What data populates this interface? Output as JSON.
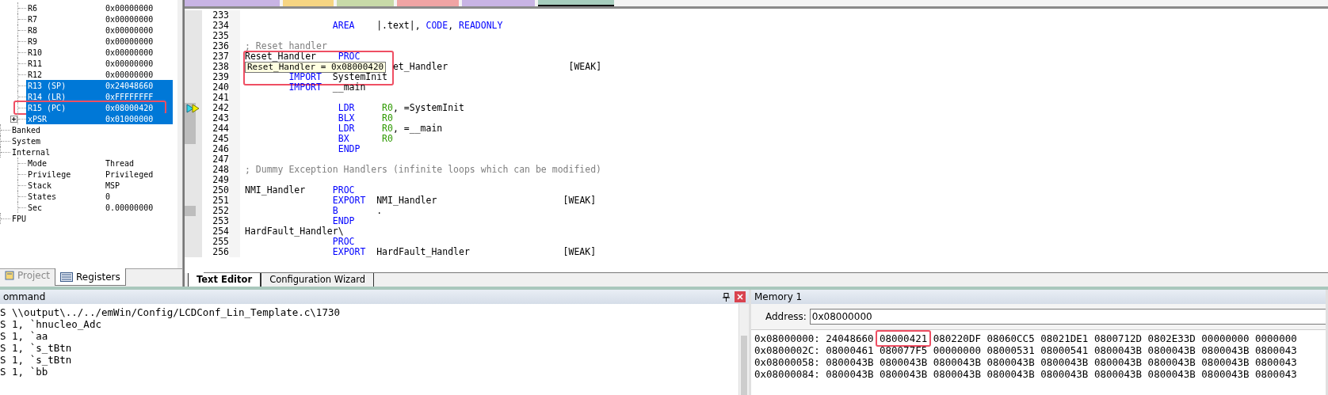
{
  "file_tabs": [
    {
      "color": "#c8b4e4",
      "selected": false
    },
    {
      "color": "#f6d582",
      "selected": false
    },
    {
      "color": "#c8daa8",
      "selected": false
    },
    {
      "color": "#f0a4a4",
      "selected": false
    },
    {
      "color": "#c8b4e4",
      "selected": false
    },
    {
      "color": "#a6cdbd",
      "selected": true
    }
  ],
  "registers": {
    "continued": [
      {
        "name": "R6",
        "value": "0x00000000",
        "selected": false,
        "highlighted": false
      },
      {
        "name": "R7",
        "value": "0x00000000",
        "selected": false,
        "highlighted": false
      },
      {
        "name": "R8",
        "value": "0x00000000",
        "selected": false,
        "highlighted": false
      },
      {
        "name": "R9",
        "value": "0x00000000",
        "selected": false,
        "highlighted": false
      },
      {
        "name": "R10",
        "value": "0x00000000",
        "selected": false,
        "highlighted": false
      },
      {
        "name": "R11",
        "value": "0x00000000",
        "selected": false,
        "highlighted": false
      },
      {
        "name": "R12",
        "value": "0x00000000",
        "selected": false,
        "highlighted": false
      },
      {
        "name": "R13 (SP)",
        "value": "0x24048660",
        "selected": true,
        "highlighted": false
      },
      {
        "name": "R14 (LR)",
        "value": "0xFFFFFFFF",
        "selected": true,
        "highlighted": false
      },
      {
        "name": "R15 (PC)",
        "value": "0x08000420",
        "selected": true,
        "highlighted": true
      },
      {
        "name": "xPSR",
        "value": "0x01000000",
        "selected": true,
        "highlighted": false,
        "expanded": false
      }
    ],
    "items": [
      {
        "name": "Banked"
      },
      {
        "name": "System"
      },
      {
        "name": "Internal",
        "children": [
          {
            "name": "Mode",
            "value": "Thread"
          },
          {
            "name": "Privilege",
            "value": "Privileged"
          },
          {
            "name": "Stack",
            "value": "MSP"
          },
          {
            "name": "States",
            "value": "0"
          },
          {
            "name": "Sec",
            "value": "0.00000000"
          }
        ]
      },
      {
        "name": "FPU"
      }
    ]
  },
  "left_tabs": [
    {
      "label": "Project",
      "selected": false,
      "kind": "project"
    },
    {
      "label": "Registers",
      "selected": true,
      "kind": "registers"
    }
  ],
  "editor": {
    "tooltip": {
      "text": "Reset_Handler = 0x08000420",
      "highlighted": true
    },
    "lines": [
      {
        "n": "233",
        "marked": false,
        "current": false
      },
      {
        "n": "234",
        "marked": false,
        "current": false,
        "tokens": [
          {
            "text": "                AREA",
            "kind": "keyword"
          },
          {
            "text": "    |.text|, ",
            "kind": "plain"
          },
          {
            "text": "CODE",
            "kind": "keyword"
          },
          {
            "text": ", ",
            "kind": "plain"
          },
          {
            "text": "READONLY",
            "kind": "keyword"
          }
        ]
      },
      {
        "n": "235",
        "marked": false,
        "current": false
      },
      {
        "n": "236",
        "marked": false,
        "current": false,
        "tokens": [
          {
            "text": "; Reset handler",
            "kind": "comment"
          }
        ]
      },
      {
        "n": "237",
        "marked": false,
        "current": false,
        "tokens": [
          {
            "text": "Reset_Handler",
            "kind": "plain"
          },
          {
            "text": "    PROC",
            "kind": "keyword"
          }
        ]
      },
      {
        "n": "238",
        "marked": false,
        "current": false,
        "tokens": [
          {
            "text": "                           et_Handler",
            "kind": "plain"
          },
          {
            "text": "                      [WEAK]",
            "kind": "plain"
          }
        ]
      },
      {
        "n": "239",
        "marked": false,
        "current": false,
        "tokens": [
          {
            "text": "        IMPORT",
            "kind": "keyword"
          },
          {
            "text": "  SystemInit",
            "kind": "plain"
          }
        ]
      },
      {
        "n": "240",
        "marked": false,
        "current": false,
        "tokens": [
          {
            "text": "        IMPORT",
            "kind": "keyword"
          },
          {
            "text": "  __main",
            "kind": "plain"
          }
        ]
      },
      {
        "n": "241",
        "marked": false,
        "current": false
      },
      {
        "n": "242",
        "marked": true,
        "current": true,
        "tokens": [
          {
            "text": "                 LDR",
            "kind": "keyword"
          },
          {
            "text": "     R0",
            "kind": "register"
          },
          {
            "text": ", =SystemInit",
            "kind": "plain"
          }
        ]
      },
      {
        "n": "243",
        "marked": true,
        "current": false,
        "tokens": [
          {
            "text": "                 BLX",
            "kind": "keyword"
          },
          {
            "text": "     R0",
            "kind": "register"
          }
        ]
      },
      {
        "n": "244",
        "marked": true,
        "current": false,
        "tokens": [
          {
            "text": "                 LDR",
            "kind": "keyword"
          },
          {
            "text": "     R0",
            "kind": "register"
          },
          {
            "text": ", =__main",
            "kind": "plain"
          }
        ]
      },
      {
        "n": "245",
        "marked": true,
        "current": false,
        "tokens": [
          {
            "text": "                 BX",
            "kind": "keyword"
          },
          {
            "text": "      R0",
            "kind": "register"
          }
        ]
      },
      {
        "n": "246",
        "marked": false,
        "current": false,
        "tokens": [
          {
            "text": "                 ENDP",
            "kind": "keyword"
          }
        ]
      },
      {
        "n": "247",
        "marked": false,
        "current": false
      },
      {
        "n": "248",
        "marked": false,
        "current": false,
        "tokens": [
          {
            "text": "; Dummy Exception Handlers (infinite loops which can be modified)",
            "kind": "comment"
          }
        ]
      },
      {
        "n": "249",
        "marked": false,
        "current": false
      },
      {
        "n": "250",
        "marked": false,
        "current": false,
        "tokens": [
          {
            "text": "NMI_Handler",
            "kind": "plain"
          },
          {
            "text": "     PROC",
            "kind": "keyword"
          }
        ]
      },
      {
        "n": "251",
        "marked": false,
        "current": false,
        "tokens": [
          {
            "text": "                EXPORT",
            "kind": "keyword"
          },
          {
            "text": "  NMI_Handler",
            "kind": "plain"
          },
          {
            "text": "                       [WEAK]",
            "kind": "plain"
          }
        ]
      },
      {
        "n": "252",
        "marked": true,
        "current": false,
        "tokens": [
          {
            "text": "                B",
            "kind": "keyword"
          },
          {
            "text": "       .",
            "kind": "plain"
          }
        ]
      },
      {
        "n": "253",
        "marked": false,
        "current": false,
        "tokens": [
          {
            "text": "                ENDP",
            "kind": "keyword"
          }
        ]
      },
      {
        "n": "254",
        "marked": false,
        "current": false,
        "tokens": [
          {
            "text": "HardFault_Handler\\",
            "kind": "plain"
          }
        ]
      },
      {
        "n": "255",
        "marked": false,
        "current": false,
        "tokens": [
          {
            "text": "                PROC",
            "kind": "keyword"
          }
        ]
      },
      {
        "n": "256",
        "marked": false,
        "current": false,
        "tokens": [
          {
            "text": "                EXPORT",
            "kind": "keyword"
          },
          {
            "text": "  HardFault_Handler",
            "kind": "plain"
          },
          {
            "text": "                 [WEAK]",
            "kind": "plain"
          }
        ]
      }
    ]
  },
  "editor_tabs": [
    {
      "label": "Text Editor",
      "selected": true
    },
    {
      "label": "Configuration Wizard",
      "selected": false
    }
  ],
  "command": {
    "title": "ommand",
    "lines": [
      "S \\\\output\\../../emWin/Config/LCDConf_Lin_Template.c\\1730",
      "S 1, `hnucleo_Adc",
      "S 1, `aa",
      "S 1, `s_tBtn",
      "S 1, `s_tBtn",
      "S 1, `bb"
    ]
  },
  "memory": {
    "title": "Memory 1",
    "address_label": "Address:",
    "address": "0x08000000",
    "rows": [
      {
        "address": "0x08000000:",
        "words": [
          {
            "value": "24048660",
            "highlighted": false
          },
          {
            "value": "08000421",
            "highlighted": true
          },
          {
            "value": "080220DF",
            "highlighted": false
          },
          {
            "value": "08060CC5",
            "highlighted": false
          },
          {
            "value": "08021DE1",
            "highlighted": false
          },
          {
            "value": "0800712D",
            "highlighted": false
          },
          {
            "value": "0802E33D",
            "highlighted": false
          },
          {
            "value": "00000000",
            "highlighted": false
          },
          {
            "value": "0000000",
            "highlighted": false
          }
        ]
      },
      {
        "address": "0x0800002C:",
        "words": [
          {
            "value": "08000461",
            "highlighted": false
          },
          {
            "value": "080077F5",
            "highlighted": false
          },
          {
            "value": "00000000",
            "highlighted": false
          },
          {
            "value": "08000531",
            "highlighted": false
          },
          {
            "value": "08000541",
            "highlighted": false
          },
          {
            "value": "0800043B",
            "highlighted": false
          },
          {
            "value": "0800043B",
            "highlighted": false
          },
          {
            "value": "0800043B",
            "highlighted": false
          },
          {
            "value": "0800043",
            "highlighted": false
          }
        ]
      },
      {
        "address": "0x08000058:",
        "words": [
          {
            "value": "0800043B",
            "highlighted": false
          },
          {
            "value": "0800043B",
            "highlighted": false
          },
          {
            "value": "0800043B",
            "highlighted": false
          },
          {
            "value": "0800043B",
            "highlighted": false
          },
          {
            "value": "0800043B",
            "highlighted": false
          },
          {
            "value": "0800043B",
            "highlighted": false
          },
          {
            "value": "0800043B",
            "highlighted": false
          },
          {
            "value": "0800043B",
            "highlighted": false
          },
          {
            "value": "0800043",
            "highlighted": false
          }
        ]
      },
      {
        "address": "0x08000084:",
        "words": [
          {
            "value": "0800043B",
            "highlighted": false
          },
          {
            "value": "0800043B",
            "highlighted": false
          },
          {
            "value": "0800043B",
            "highlighted": false
          },
          {
            "value": "0800043B",
            "highlighted": false
          },
          {
            "value": "0800043B",
            "highlighted": false
          },
          {
            "value": "0800043B",
            "highlighted": false
          },
          {
            "value": "0800043B",
            "highlighted": false
          },
          {
            "value": "0800043B",
            "highlighted": false
          },
          {
            "value": "0800043",
            "highlighted": false
          }
        ]
      }
    ]
  }
}
